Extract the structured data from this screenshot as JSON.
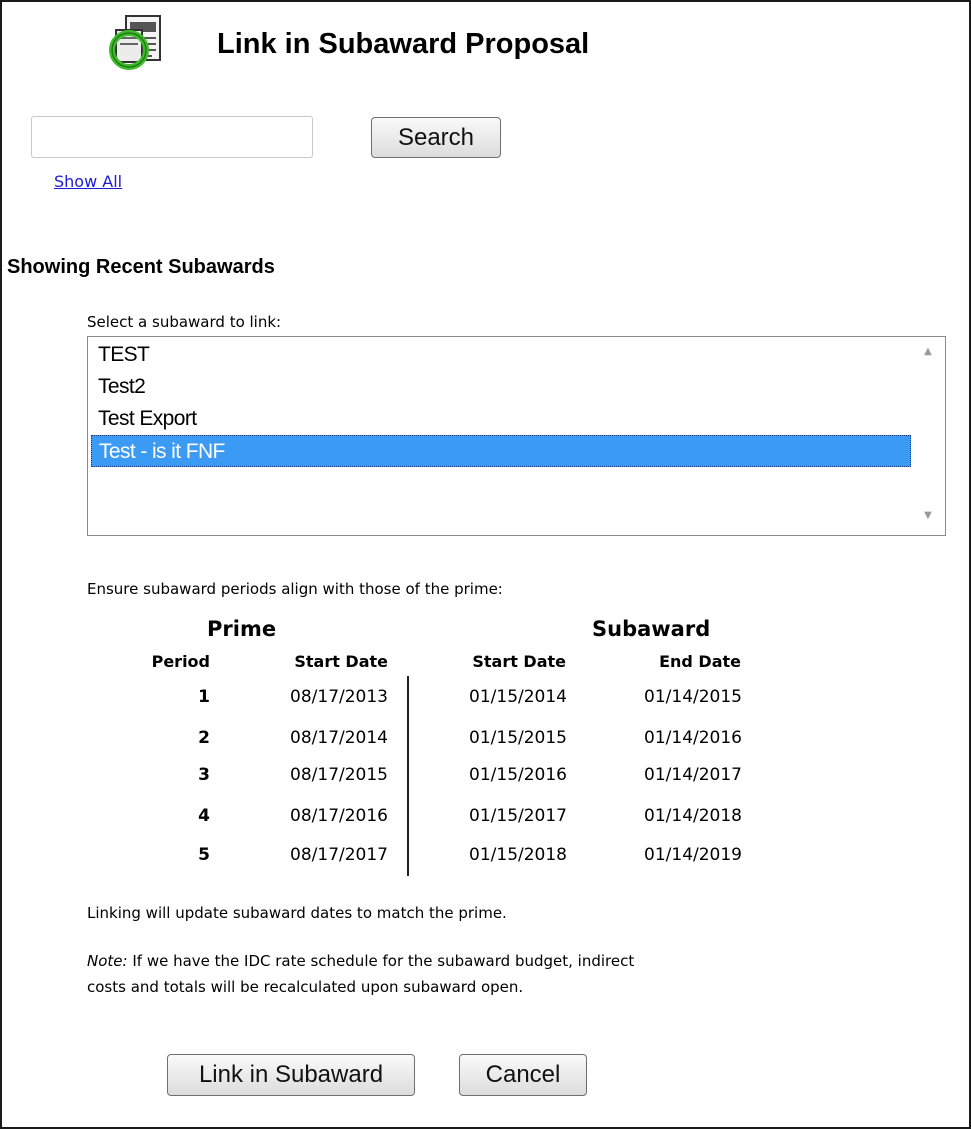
{
  "dialog": {
    "title": "Link in Subaward Proposal",
    "icon": "document-link-icon"
  },
  "search": {
    "value": "",
    "placeholder": "",
    "button_label": "Search",
    "show_all_label": "Show All"
  },
  "recent": {
    "heading": "Showing Recent Subawards",
    "select_label": "Select a subaward to link:",
    "items": [
      "TEST",
      "Test2",
      "Test Export",
      "Test - is it FNF"
    ],
    "selected_index": 3
  },
  "periods": {
    "instruction": "Ensure subaward periods align with those of the prime:",
    "prime_heading": "Prime",
    "subaward_heading": "Subaward",
    "columns": {
      "period": "Period",
      "prime_start": "Start Date",
      "sub_start": "Start Date",
      "sub_end": "End Date"
    },
    "rows": [
      {
        "period": "1",
        "prime_start": "08/17/2013",
        "sub_start": "01/15/2014",
        "sub_end": "01/14/2015"
      },
      {
        "period": "2",
        "prime_start": "08/17/2014",
        "sub_start": "01/15/2015",
        "sub_end": "01/14/2016"
      },
      {
        "period": "3",
        "prime_start": "08/17/2015",
        "sub_start": "01/15/2016",
        "sub_end": "01/14/2017"
      },
      {
        "period": "4",
        "prime_start": "08/17/2016",
        "sub_start": "01/15/2017",
        "sub_end": "01/14/2018"
      },
      {
        "period": "5",
        "prime_start": "08/17/2017",
        "sub_start": "01/15/2018",
        "sub_end": "01/14/2019"
      }
    ]
  },
  "notes": {
    "update_text": "Linking will update subaward dates to match the prime.",
    "note_label": "Note:",
    "note_line1": "If we have the IDC rate schedule for the subaward budget, indirect",
    "note_line2": "costs and totals will be recalculated upon subaward open."
  },
  "actions": {
    "link_label": "Link in Subaward",
    "cancel_label": "Cancel"
  },
  "colors": {
    "selection": "#3b9af4",
    "link": "#1c1cd3",
    "icon_ring": "#3dbb2a"
  }
}
